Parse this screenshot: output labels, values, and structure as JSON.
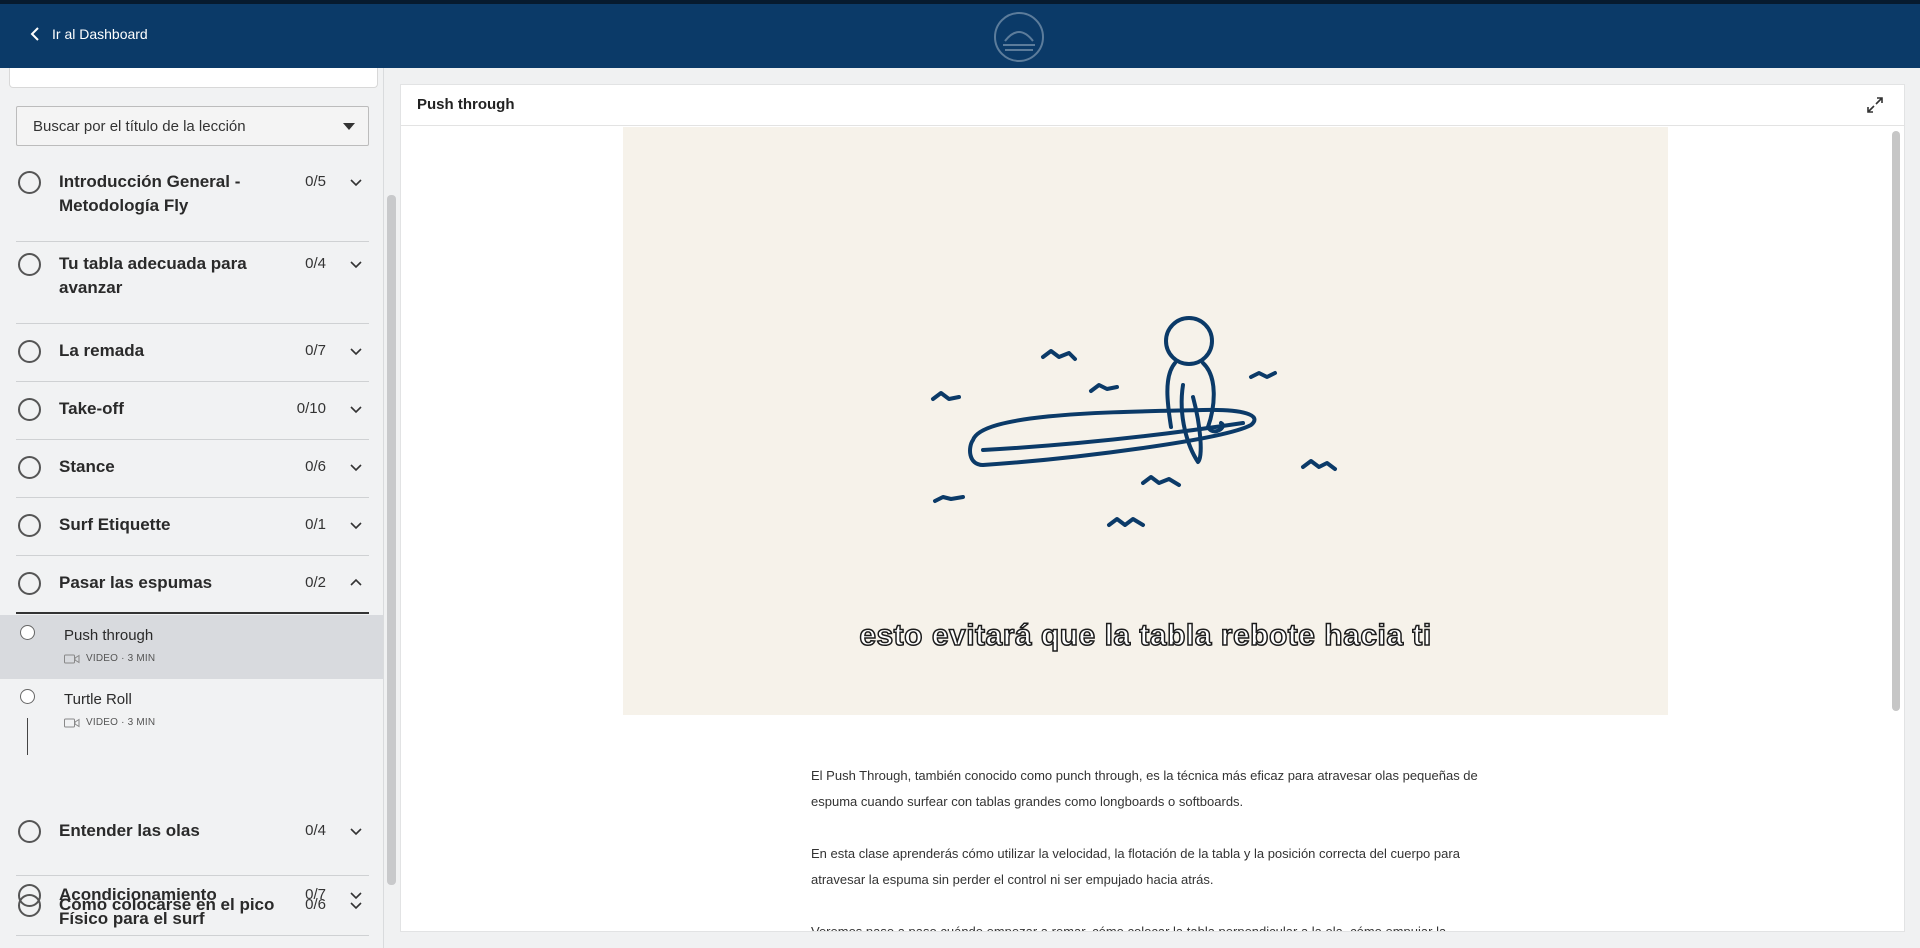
{
  "topbar": {
    "back_label": "Ir al Dashboard"
  },
  "sidebar": {
    "search_placeholder": "Buscar por el título de la lección",
    "sections": [
      {
        "title": "Introducción General - Metodología Fly",
        "count": "0/5",
        "expanded": false
      },
      {
        "title": "Tu tabla adecuada para avanzar",
        "count": "0/4",
        "expanded": false
      },
      {
        "title": "La remada",
        "count": "0/7",
        "expanded": false
      },
      {
        "title": "Take-off",
        "count": "0/10",
        "expanded": false
      },
      {
        "title": "Stance",
        "count": "0/6",
        "expanded": false
      },
      {
        "title": "Surf Etiquette",
        "count": "0/1",
        "expanded": false
      },
      {
        "title": "Pasar las espumas",
        "count": "0/2",
        "expanded": true
      },
      {
        "title": "Entender las olas",
        "count": "0/4",
        "expanded": false
      },
      {
        "title": "Cómo colocarse en el pico",
        "count": "0/6",
        "expanded": false
      },
      {
        "title": "Acondicionamiento Físico para el surf",
        "count": "0/7",
        "expanded": false
      }
    ],
    "lessons": [
      {
        "title": "Push through",
        "meta": "VIDEO · 3 MIN",
        "active": true
      },
      {
        "title": "Turtle Roll",
        "meta": "VIDEO · 3 MIN",
        "active": false
      }
    ]
  },
  "content": {
    "title": "Push through",
    "video": {
      "subtitle": "esto evitará que la tabla rebote hacia ti",
      "bg_color": "#f6f2ea",
      "ink_color": "#0b3a68"
    },
    "paragraphs": [
      "El Push Through, también conocido como punch through, es la técnica más eficaz para atravesar olas pequeñas de espuma cuando surfear con tablas grandes como longboards o softboards.",
      "En esta clase aprenderás cómo utilizar la velocidad, la flotación de la tabla y la posición correcta del cuerpo para atravesar la espuma sin perder el control ni ser empujado hacia atrás.",
      "Veremos paso a paso cuándo empezar a remar, cómo colocar la tabla perpendicular a la ola, cómo empujar la"
    ]
  },
  "colors": {
    "brand": "#0b3a68",
    "sidebar_bg": "#f1f2f3",
    "active_lesson_bg": "#d8dade"
  }
}
